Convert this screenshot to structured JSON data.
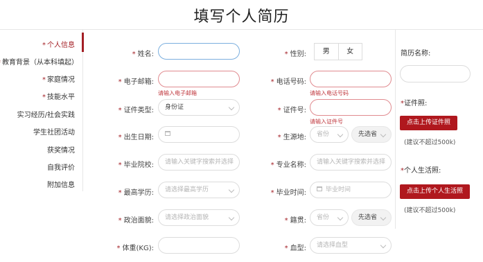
{
  "page": {
    "title": "填写个人简历"
  },
  "sidebar": {
    "items": [
      {
        "label": "个人信息",
        "required": "*",
        "active": true
      },
      {
        "label": "教育背景（从本科填起）",
        "required": "*"
      },
      {
        "label": "家庭情况",
        "required": "*"
      },
      {
        "label": "技能水平",
        "required": "*"
      },
      {
        "label": "实习经历/社会实践",
        "required": ""
      },
      {
        "label": "学生社团活动",
        "required": ""
      },
      {
        "label": "获奖情况",
        "required": ""
      },
      {
        "label": "自我评价",
        "required": ""
      },
      {
        "label": "附加信息",
        "required": ""
      }
    ]
  },
  "form": {
    "name": {
      "req": "*",
      "label": "姓名:",
      "value": ""
    },
    "gender": {
      "req": "*",
      "label": "性别:",
      "options": [
        "男",
        "女"
      ]
    },
    "email": {
      "req": "*",
      "label": "电子邮箱:",
      "value": "",
      "error": "请输入电子邮箱"
    },
    "phone": {
      "req": "*",
      "label": "电话号码:",
      "value": "",
      "error": "请输入电话号码"
    },
    "id_type": {
      "req": "*",
      "label": "证件类型:",
      "value": "身份证"
    },
    "id_number": {
      "req": "*",
      "label": "证件号:",
      "value": "",
      "error": "请输入证件号"
    },
    "birth_date": {
      "req": "*",
      "label": "出生日期:",
      "value": ""
    },
    "origin": {
      "req": "*",
      "label": "生源地:",
      "province_placeholder": "省份",
      "city_button": "先选省"
    },
    "school": {
      "req": "*",
      "label": "毕业院校:",
      "placeholder": "请输入关键字搜索并选择"
    },
    "major": {
      "req": "*",
      "label": "专业名称:",
      "placeholder": "请输入关键字搜索并选择"
    },
    "degree": {
      "req": "*",
      "label": "最高学历:",
      "placeholder": "请选择最高学历"
    },
    "grad_time": {
      "req": "*",
      "label": "毕业时间:",
      "placeholder": "毕业时间"
    },
    "politics": {
      "req": "*",
      "label": "政治面貌:",
      "placeholder": "请选择政治面貌"
    },
    "native_place": {
      "req": "*",
      "label": "籍贯:",
      "province_placeholder": "省份",
      "city_button": "先选省"
    },
    "weight": {
      "req": "*",
      "label": "体重(KG):",
      "value": ""
    },
    "blood_type": {
      "req": "*",
      "label": "血型:",
      "placeholder": "请选择血型"
    }
  },
  "right_panel": {
    "resume_name_label": "简历名称:",
    "id_photo": {
      "req": "*",
      "label": "证件照:",
      "button": "点击上传证件照",
      "hint": "(建议不超过500k)"
    },
    "life_photo": {
      "req": "*",
      "label": "个人生活照:",
      "button": "点击上传个人生活照",
      "hint": "(建议不超过500k)"
    }
  },
  "colors": {
    "accent": "#a31e24",
    "error": "#c0393f",
    "focus": "#7aaede",
    "button": "#b0181e"
  }
}
